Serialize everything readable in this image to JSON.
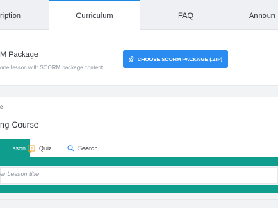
{
  "tabs": [
    {
      "label": "ription"
    },
    {
      "label": "Curriculum"
    },
    {
      "label": "FAQ"
    },
    {
      "label": "Announ"
    }
  ],
  "scorm": {
    "title": "M Package",
    "description": "one lesson with SCORM package content.",
    "button_label": "CHOOSE SCORM PACKAGE (.ZIP)",
    "button_icon": "paperclip-icon"
  },
  "course": {
    "label": "e",
    "value": "ng Course"
  },
  "builder": {
    "tabs": [
      {
        "label": "sson",
        "icon": ""
      },
      {
        "label": "Quiz",
        "icon": "quiz-icon"
      },
      {
        "label": "Search",
        "icon": "search-icon"
      }
    ],
    "lesson_placeholder": "er Lesson title"
  },
  "colors": {
    "accent_blue": "#2a8cf0",
    "active_tab_border": "#1e88e5",
    "teal": "#0f9d8e",
    "quiz_icon": "#f0a020"
  }
}
